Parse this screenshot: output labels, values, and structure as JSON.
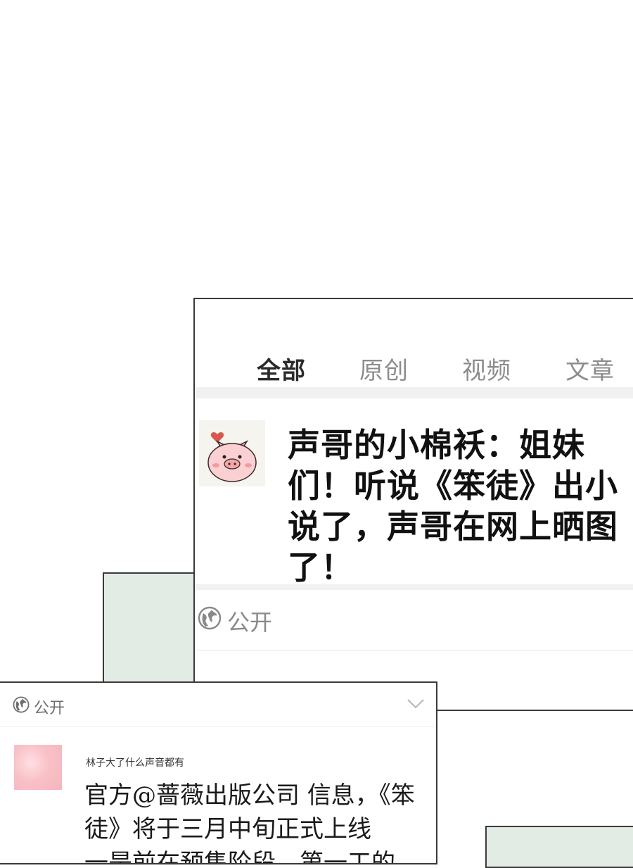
{
  "tabs": [
    {
      "label": "全部",
      "active": true
    },
    {
      "label": "原创",
      "active": false
    },
    {
      "label": "视频",
      "active": false
    },
    {
      "label": "文章",
      "active": false
    }
  ],
  "post": {
    "text": "声哥的小棉袄：姐妹们！听说《笨徒》出小说了，声哥在网上晒图了！",
    "privacy": "公开",
    "avatar_icon": "pig-avatar-icon"
  },
  "second_post": {
    "privacy": "公开",
    "username": "林子大了什么声音都有",
    "text": "官方@蔷薇出版公司 信息，《笨徒》将于三月中旬正式上线",
    "text_cut": "一是前在预售阶段，第一工的"
  },
  "colors": {
    "accent": "#f2a200",
    "panel_green": "#e3ece4",
    "border": "#3a3a3a"
  }
}
